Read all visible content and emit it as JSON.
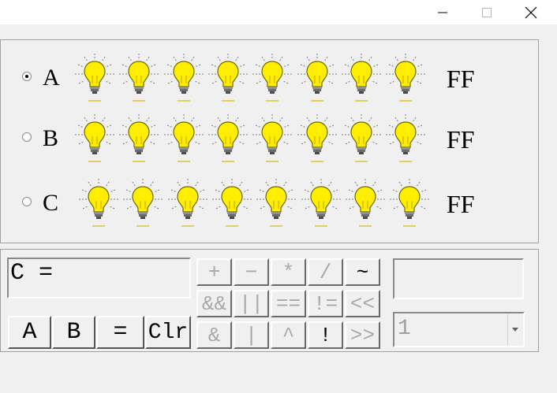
{
  "window": {
    "minimize_glyph": "—",
    "maximize_glyph": "☐",
    "close_glyph": "✕"
  },
  "rows": [
    {
      "label": "A",
      "value": "FF",
      "selected": true
    },
    {
      "label": "B",
      "value": "FF",
      "selected": false
    },
    {
      "label": "C",
      "value": "FF",
      "selected": false
    }
  ],
  "expression": {
    "text": "C ="
  },
  "buttons": {
    "a": "A",
    "b": "B",
    "eq": "=",
    "clr": "Clr"
  },
  "operators": {
    "row1": [
      "+",
      "−",
      "*",
      "/",
      "~"
    ],
    "row2": [
      "&&",
      "||",
      "==",
      "!=",
      "<<"
    ],
    "row3": [
      "&",
      "|",
      "^",
      "!",
      ">>"
    ]
  },
  "result": {
    "text": ""
  },
  "combo": {
    "selected": "1"
  },
  "colors": {
    "bulb_fill": "#ffee00",
    "bulb_ray": "#7a7a7a",
    "disabled_text": "#a8a8a8"
  }
}
